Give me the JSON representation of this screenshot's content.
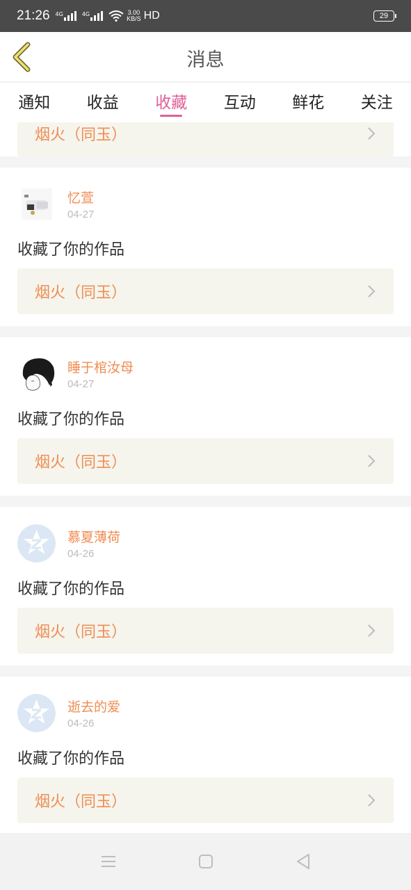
{
  "status_bar": {
    "time": "21:26",
    "net1": "4G",
    "net2": "4G",
    "speed_top": "3.00",
    "speed_bottom": "KB/S",
    "hd": "HD",
    "battery": "29"
  },
  "header": {
    "title": "消息"
  },
  "tabs": [
    {
      "label": "通知"
    },
    {
      "label": "收益"
    },
    {
      "label": "收藏",
      "active": true
    },
    {
      "label": "互动"
    },
    {
      "label": "鲜花"
    },
    {
      "label": "关注"
    }
  ],
  "partial_item": {
    "work_title": "烟火（同玉）"
  },
  "items": [
    {
      "username": "忆萱",
      "date": "04-27",
      "action": "收藏了你的作品",
      "work_title": "烟火（同玉）",
      "avatar": "photo"
    },
    {
      "username": "睡于棺汝母",
      "date": "04-27",
      "action": "收藏了你的作品",
      "work_title": "烟火（同玉）",
      "avatar": "sketch"
    },
    {
      "username": "慕夏薄荷",
      "date": "04-26",
      "action": "收藏了你的作品",
      "work_title": "烟火（同玉）",
      "avatar": "default-star"
    },
    {
      "username": "逝去的爱",
      "date": "04-26",
      "action": "收藏了你的作品",
      "work_title": "烟火（同玉）",
      "avatar": "default-star"
    }
  ],
  "colors": {
    "accent": "#e05f9a",
    "username": "#f08c52",
    "work_title": "#f08c52",
    "work_box_bg": "#f5f5ed"
  }
}
